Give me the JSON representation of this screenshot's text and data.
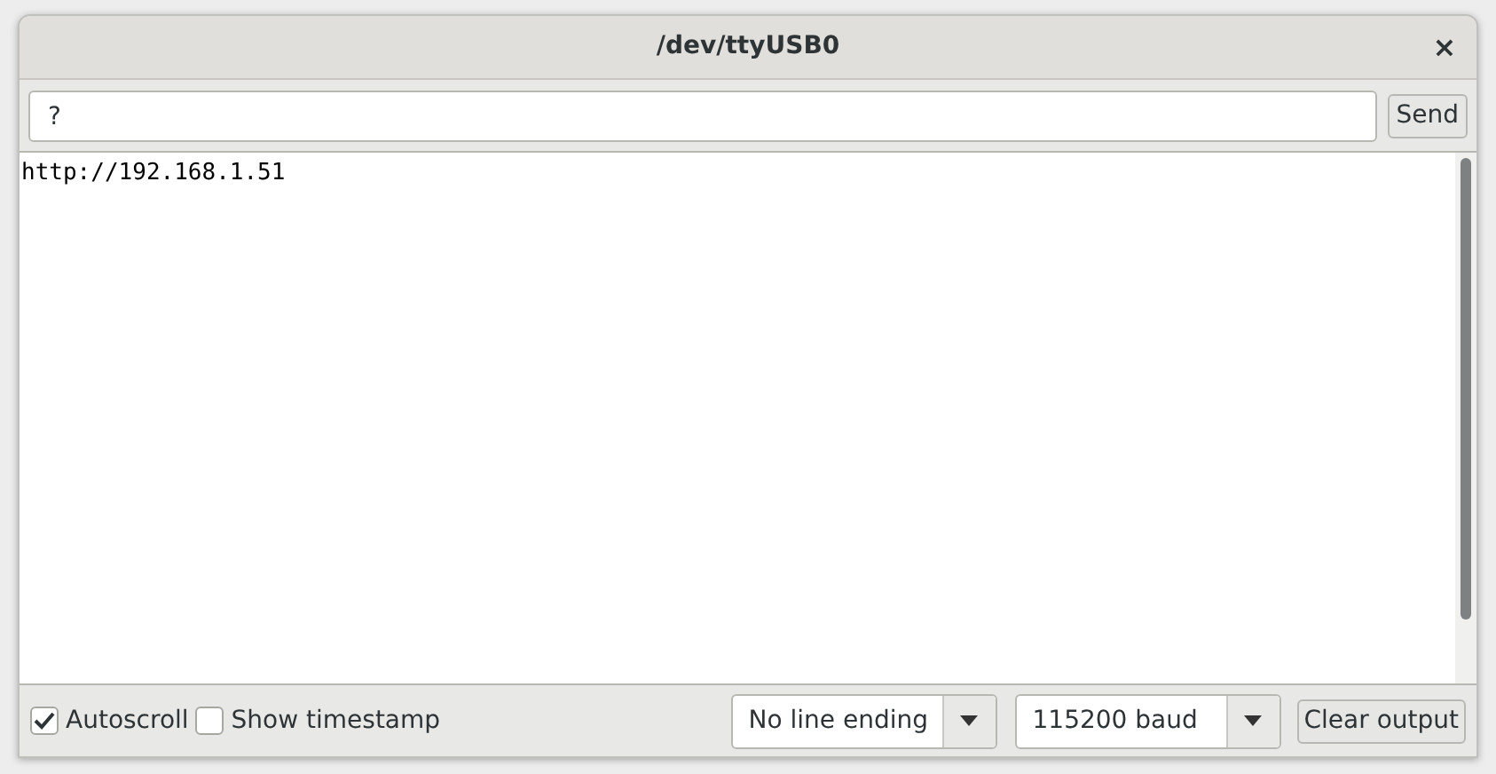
{
  "window": {
    "title": "/dev/ttyUSB0",
    "close": "×"
  },
  "input": {
    "value": "?"
  },
  "send_button": "Send",
  "output": {
    "lines": [
      "http://192.168.1.51"
    ]
  },
  "options": [
    {
      "label": "Autoscroll",
      "checked": true
    },
    {
      "label": "Show timestamp",
      "checked": false
    }
  ],
  "line_ending": {
    "value": "No line ending"
  },
  "baud": {
    "value": "115200 baud"
  },
  "clear_button": "Clear output"
}
